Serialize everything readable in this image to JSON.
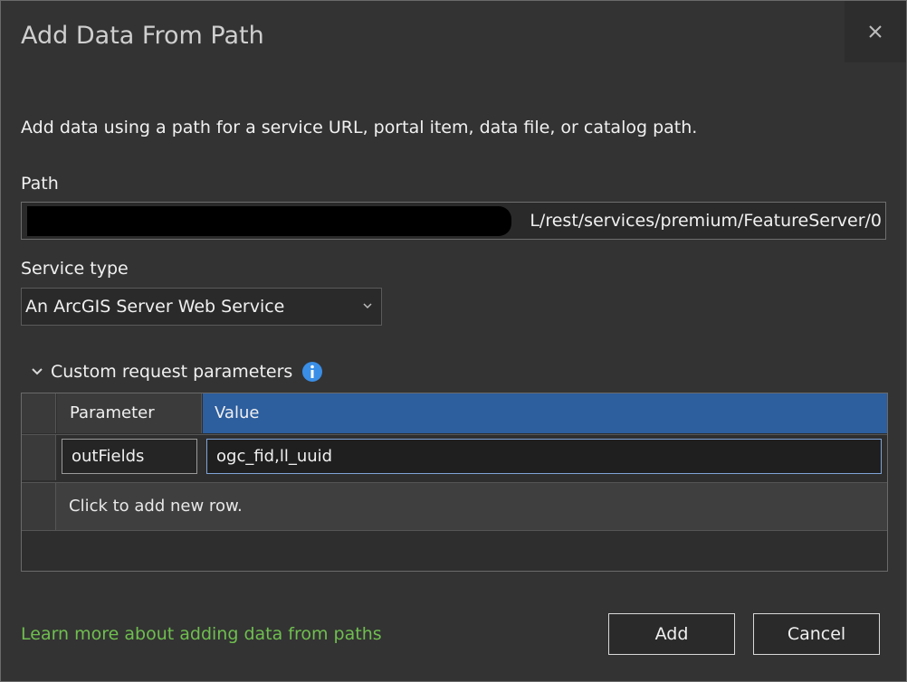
{
  "dialog": {
    "title": "Add Data From Path",
    "close_icon": "close-icon",
    "description": "Add data using a path for a service URL, portal item, data file, or catalog path."
  },
  "path": {
    "label": "Path",
    "value_visible": "L/rest/services/premium/FeatureServer/0"
  },
  "service_type": {
    "label": "Service type",
    "selected": "An ArcGIS Server Web Service",
    "caret_icon": "caret-down-icon"
  },
  "custom_params": {
    "expander_icon": "chevron-down-icon",
    "label": "Custom request parameters",
    "info_icon": "info-icon",
    "columns": [
      "Parameter",
      "Value"
    ],
    "rows": [
      {
        "parameter": "outFields",
        "value": "ogc_fid,ll_uuid"
      }
    ],
    "add_row_text": "Click to add new row."
  },
  "footer": {
    "learn_more": "Learn more about adding data from paths",
    "add_label": "Add",
    "cancel_label": "Cancel"
  },
  "colors": {
    "background": "#333333",
    "header_value": "#2d5e9e",
    "info_icon": "#3a8ee6",
    "link": "#6fbf4f"
  }
}
